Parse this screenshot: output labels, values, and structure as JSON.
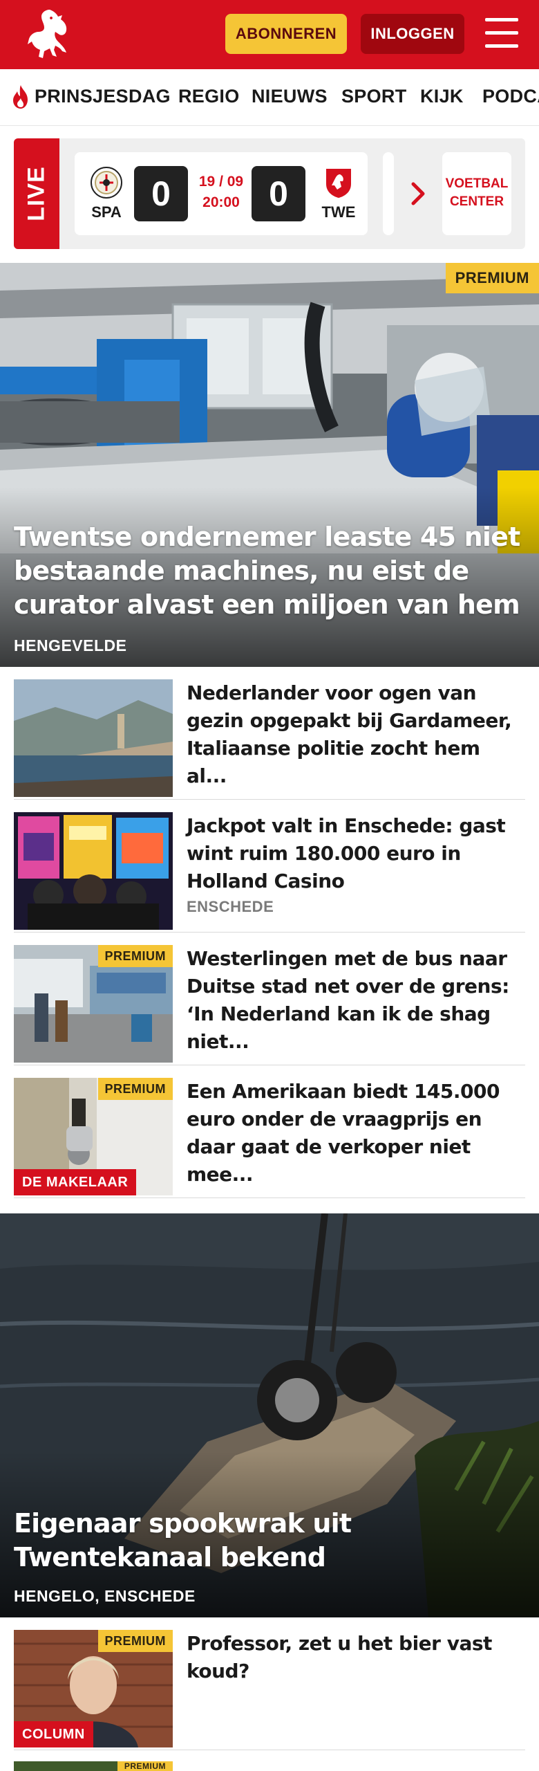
{
  "header": {
    "subscribe_label": "ABONNEREN",
    "login_label": "INLOGGEN"
  },
  "nav": {
    "items": [
      "PRINSJESDAG",
      "REGIO",
      "NIEUWS",
      "SPORT",
      "KIJK",
      "PODCA"
    ]
  },
  "live": {
    "label": "LIVE",
    "match": {
      "home_code": "SPA",
      "away_code": "TWE",
      "home_score": "0",
      "away_score": "0",
      "date": "19 / 09",
      "time": "20:00"
    },
    "voetbal_center_label": "VOETBAL CENTER"
  },
  "hero1": {
    "premium_label": "PREMIUM",
    "title": "Twentse ondernemer leaste 45 niet bestaande machines, nu eist de curator alvast een miljoen van hem",
    "location": "HENGEVELDE"
  },
  "articles": [
    {
      "title": "Nederlander voor ogen van gezin opgepakt bij Gardameer, Italiaanse politie zocht hem al...",
      "location": "",
      "premium": "",
      "label": ""
    },
    {
      "title": "Jackpot valt in Enschede: gast wint ruim 180.000 euro in Holland Casino",
      "location": "ENSCHEDE",
      "premium": "",
      "label": ""
    },
    {
      "title": "Westerlingen met de bus naar Duitse stad net over de grens: ‘In Nederland kan ik de shag niet...",
      "location": "",
      "premium": "PREMIUM",
      "label": ""
    },
    {
      "title": "Een Amerikaan biedt 145.000 euro onder de vraagprijs en daar gaat de verkoper niet mee...",
      "location": "",
      "premium": "PREMIUM",
      "label": "DE MAKELAAR"
    }
  ],
  "hero2": {
    "title": "Eigenaar spookwrak uit Twentekanaal bekend",
    "location": "HENGELO, ENSCHEDE"
  },
  "articles2": [
    {
      "title": "Professor, zet u het bier vast koud?",
      "premium": "PREMIUM",
      "label": "COLUMN"
    }
  ],
  "peek": {
    "premium": "PREMIUM"
  },
  "colors": {
    "brand_red": "#d5101e",
    "premium_yellow": "#f5c536",
    "login_dark_red": "#a0070f"
  },
  "icons": [
    "twente-horse-logo",
    "hamburger-menu-icon",
    "flame-icon",
    "sparta-crest-icon",
    "twente-crest-icon",
    "chevron-right-icon"
  ]
}
